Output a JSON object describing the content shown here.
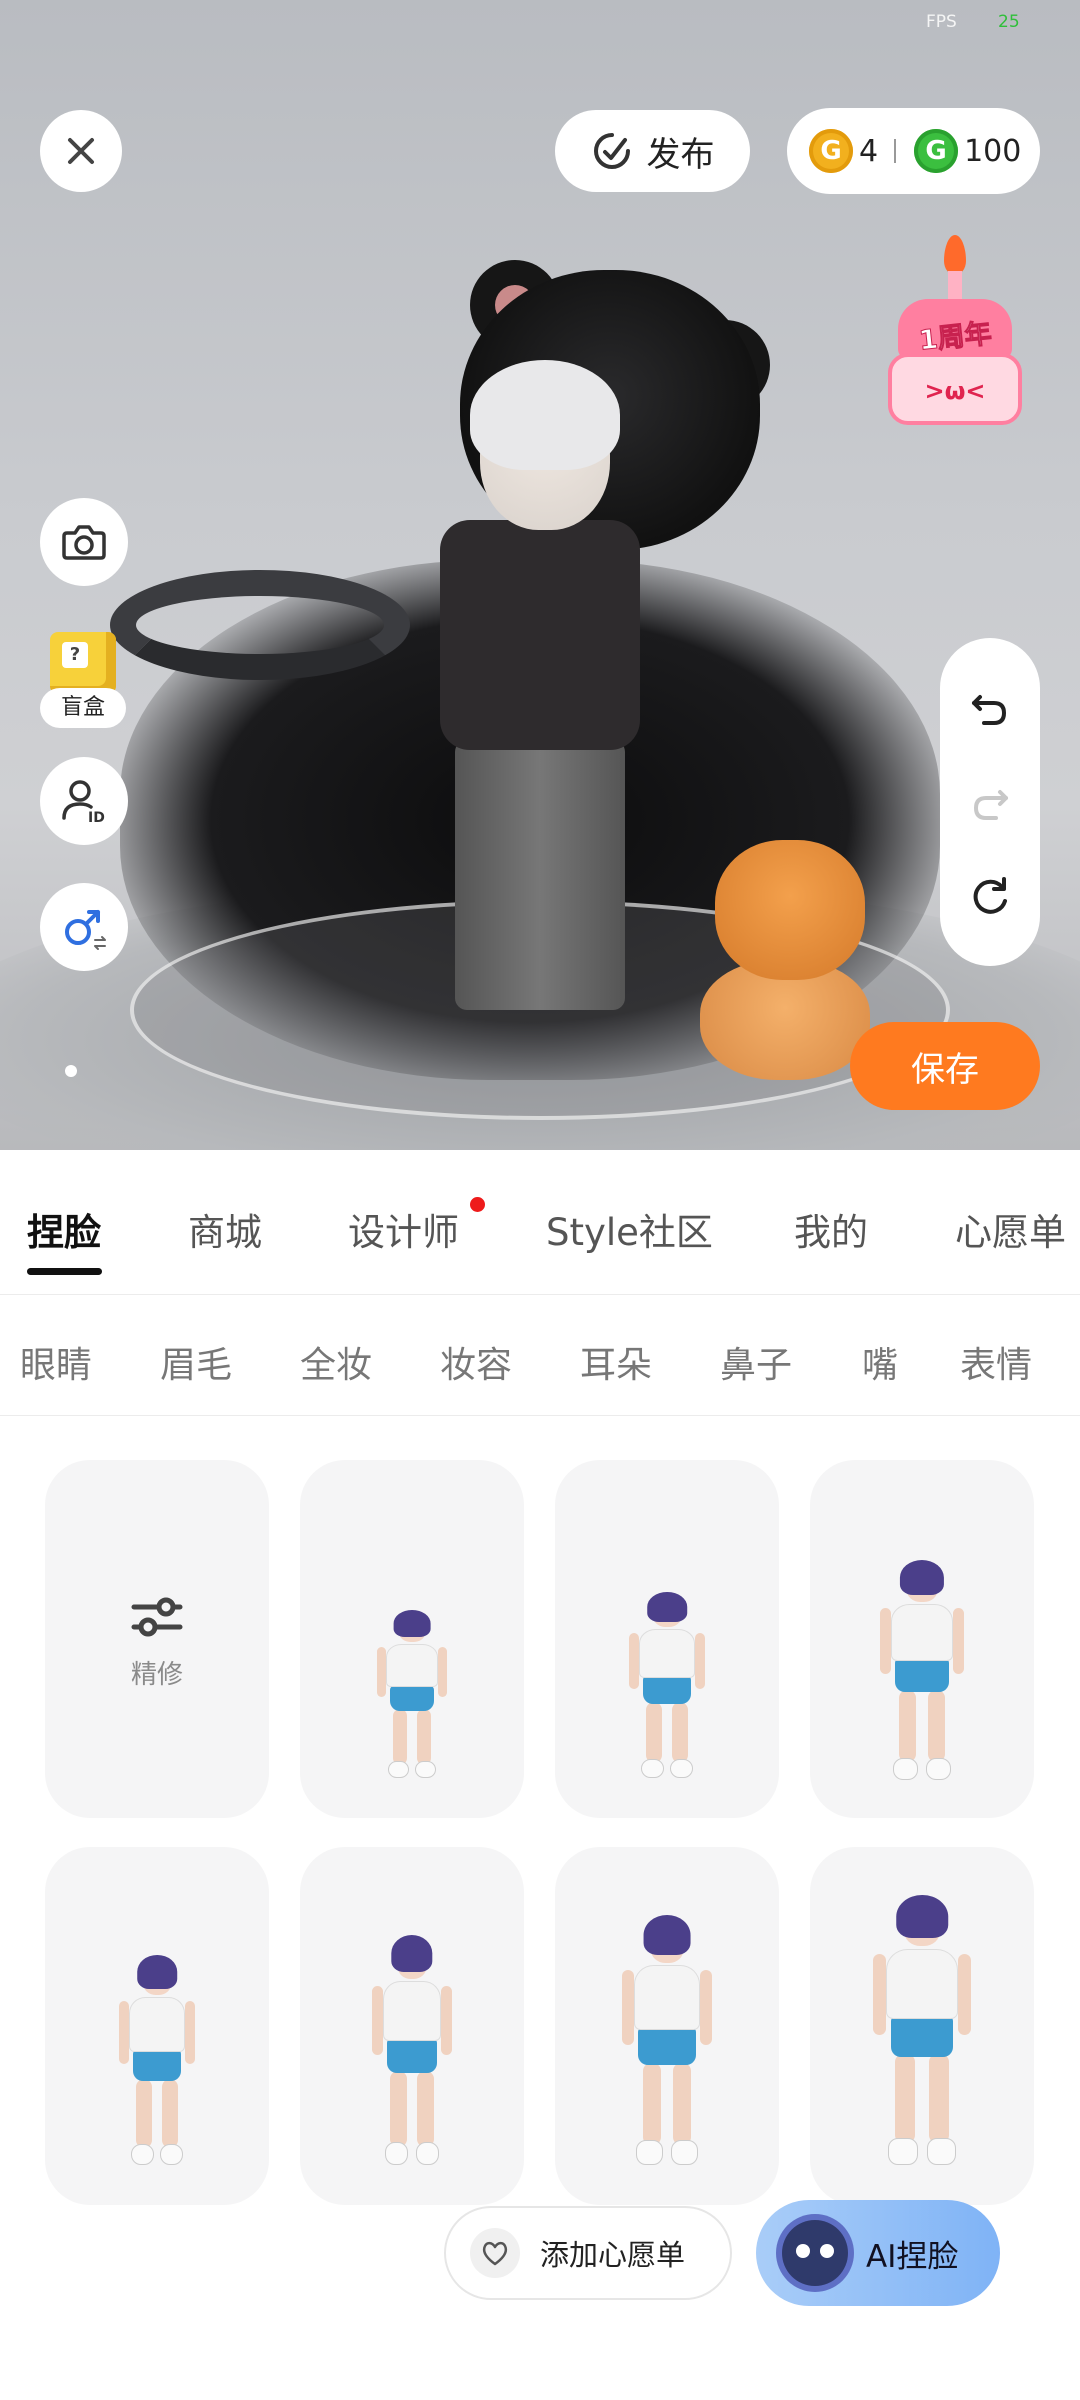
{
  "status": {
    "fps_label": "FPS",
    "fps_value": "25"
  },
  "top_bar": {
    "publish_label": "发布",
    "currency": {
      "gold_amount": "4",
      "green_amount": "100",
      "gold_icon_letter": "G",
      "green_icon_letter": "G"
    }
  },
  "anniversary_badge": {
    "label": "1周年",
    "face": ">ω<"
  },
  "left_tools": {
    "blindbox_label": "盲盒",
    "blindbox_glyph": "?"
  },
  "save_label": "保存",
  "tabs": [
    {
      "label": "捏脸",
      "active": true
    },
    {
      "label": "商城"
    },
    {
      "label": "设计师",
      "badge": "red-dot"
    },
    {
      "label": "Style社区"
    },
    {
      "label": "我的"
    },
    {
      "label": "心愿单"
    }
  ],
  "subtabs": [
    "眼睛",
    "眉毛",
    "全妆",
    "妆容",
    "耳朵",
    "鼻子",
    "嘴",
    "表情"
  ],
  "grid": {
    "refine_label": "精修"
  },
  "bottom": {
    "wishlist_label": "添加心愿单",
    "ai_label": "AI捏脸"
  },
  "colors": {
    "accent_orange": "#ff7a1f",
    "notification_red": "#ee1b1b",
    "ai_blue": "#7fb3f6"
  }
}
